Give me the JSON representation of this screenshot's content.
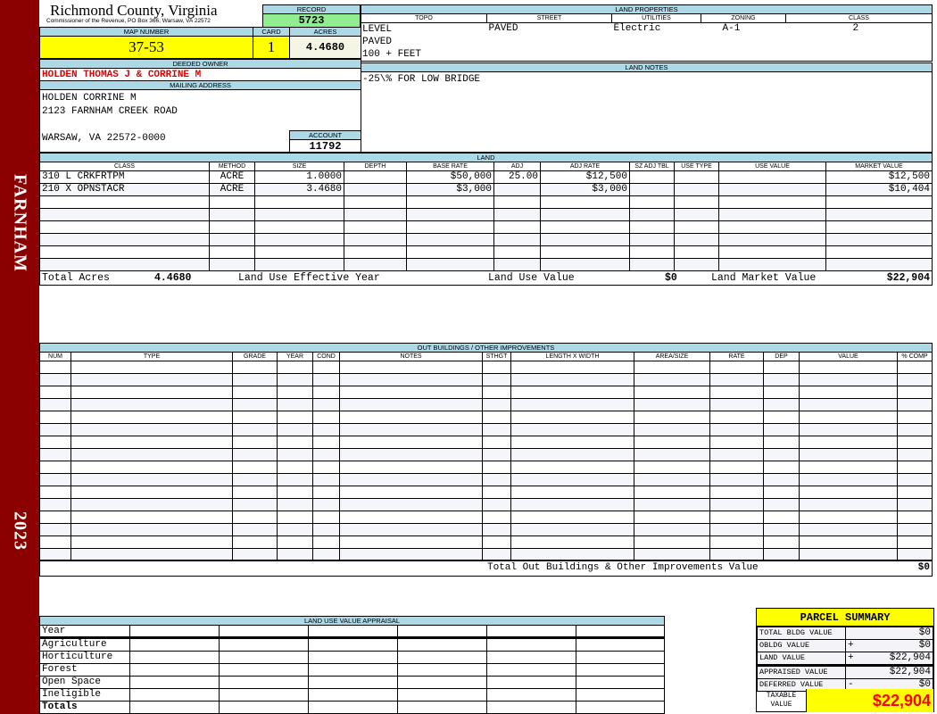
{
  "sidebar": {
    "district": "FARNHAM",
    "year": "2023",
    "color": "#8b0000"
  },
  "header": {
    "county": "Richmond County, Virginia",
    "office": "Commissioner of the Revenue, PO Box 366, Warsaw, VA 22572"
  },
  "record": {
    "label": "RECORD",
    "value": "5723"
  },
  "map": {
    "label": "MAP NUMBER",
    "value": "37-53"
  },
  "card": {
    "label": "CARD",
    "value": "1"
  },
  "acres": {
    "label": "ACRES",
    "value": "4.4680"
  },
  "owner": {
    "label": "DEEDED OWNER",
    "value": "HOLDEN THOMAS J & CORRINE M"
  },
  "mailing": {
    "label": "MAILING ADDRESS",
    "line1": "HOLDEN CORRINE M",
    "line2": "2123 FARNHAM CREEK ROAD",
    "line3": "WARSAW, VA 22572-0000"
  },
  "account": {
    "label": "ACCOUNT",
    "value": "11792"
  },
  "land_properties": {
    "title": "LAND PROPERTIES",
    "headers": [
      "TOPO",
      "STREET",
      "UTILITIES",
      "ZONING",
      "CLASS"
    ],
    "topo": [
      "LEVEL",
      "PAVED",
      "100 + FEET"
    ],
    "street": "PAVED",
    "utilities": "Electric",
    "zoning": "A-1",
    "class": "2"
  },
  "land_notes": {
    "title": "LAND NOTES",
    "text": "-25\\% FOR LOW BRIDGE"
  },
  "land": {
    "title": "LAND",
    "headers": [
      "CLASS",
      "METHOD",
      "SIZE",
      "DEPTH",
      "BASE RATE",
      "ADJ",
      "ADJ RATE",
      "SZ ADJ TBL",
      "USE TYPE",
      "USE VALUE",
      "MARKET VALUE"
    ],
    "rows": [
      [
        "310 L CRKFRTPM",
        "ACRE",
        "1.0000",
        "",
        "$50,000",
        "25.00",
        "$12,500",
        "",
        "",
        "",
        "$12,500"
      ],
      [
        "210 X OPNSTACR",
        "ACRE",
        "3.4680",
        "",
        "$3,000",
        "",
        "$3,000",
        "",
        "",
        "",
        "$10,404"
      ]
    ],
    "totals": {
      "acres_label": "Total Acres",
      "acres": "4.4680",
      "eff_year_label": "Land Use Effective Year",
      "eff_year": "",
      "use_value_label": "Land Use Value",
      "use_value": "$0",
      "market_label": "Land Market Value",
      "market": "$22,904"
    }
  },
  "outbuildings": {
    "title": "OUT BUILDINGS / OTHER IMPROVEMENTS",
    "headers": [
      "NUM",
      "TYPE",
      "GRADE",
      "YEAR",
      "COND",
      "NOTES",
      "STHGT",
      "LENGTH X WIDTH",
      "AREA/SIZE",
      "RATE",
      "DEP",
      "VALUE",
      "% COMP"
    ],
    "total_label": "Total Out Buildings & Other Improvements Value",
    "total": "$0"
  },
  "land_use": {
    "title": "LAND USE VALUE APPRAISAL",
    "year_label": "Year",
    "rows": [
      "Agriculture",
      "Horticulture",
      "Forest",
      "Open Space",
      "Ineligible"
    ],
    "totals_label": "Totals"
  },
  "parcel_summary": {
    "title": "PARCEL SUMMARY",
    "rows": [
      {
        "label": "TOTAL BLDG VALUE",
        "op": "",
        "value": "$0"
      },
      {
        "label": "OBLDG VALUE",
        "op": "+",
        "value": "$0"
      },
      {
        "label": "LAND VALUE",
        "op": "+",
        "value": "$22,904"
      },
      {
        "label": "APPRAISED VALUE",
        "op": "",
        "value": "$22,904"
      },
      {
        "label": "DEFERRED VALUE",
        "op": "-",
        "value": "$0"
      }
    ],
    "taxable_label": "TAXABLE VALUE",
    "taxable": "$22,904",
    "highlight": "#ffff00",
    "value_color": "#ff0000"
  }
}
